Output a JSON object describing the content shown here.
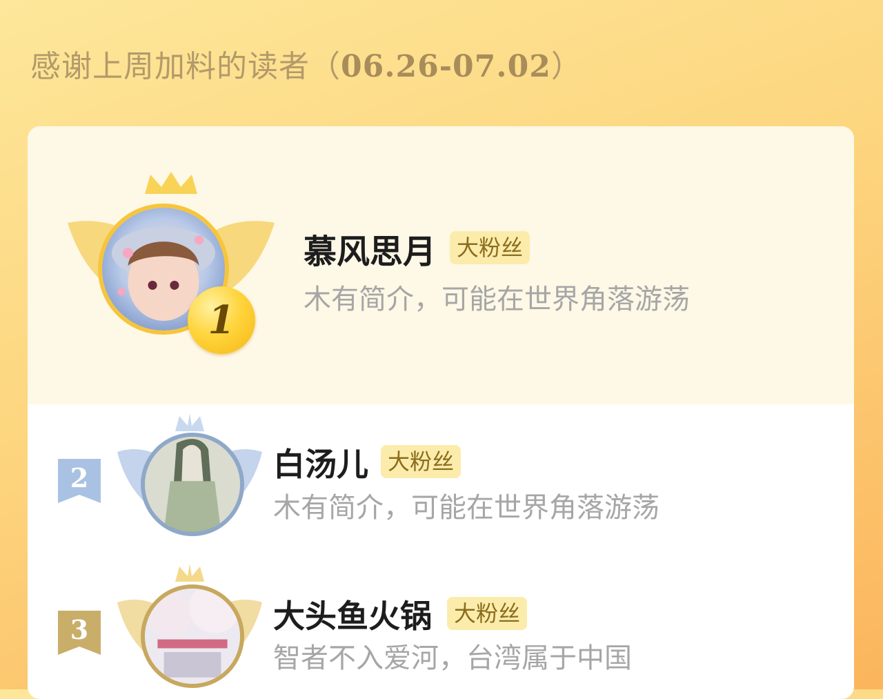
{
  "header": {
    "title": "感谢上周加料的读者（",
    "range": "06.26-07.02",
    "close_paren": "）"
  },
  "ranking": [
    {
      "rank": "1",
      "name": "慕风思月",
      "badge": "大粉丝",
      "bio": "木有简介，可能在世界角落游荡",
      "ring_color": "#f7c53b"
    },
    {
      "rank": "2",
      "name": "白汤儿",
      "badge": "大粉丝",
      "bio": "木有简介，可能在世界角落游荡",
      "ring_color": "#8fa8c8"
    },
    {
      "rank": "3",
      "name": "大头鱼火锅",
      "badge": "大粉丝",
      "bio": "智者不入爱河，台湾属于中国",
      "ring_color": "#c7a85e"
    }
  ],
  "colors": {
    "gold": "#f7c53b",
    "silver": "#a9c2e3",
    "bronze": "#c9ae6a",
    "badge_bg": "#fcecab",
    "bio_text": "#a6a6a6"
  }
}
